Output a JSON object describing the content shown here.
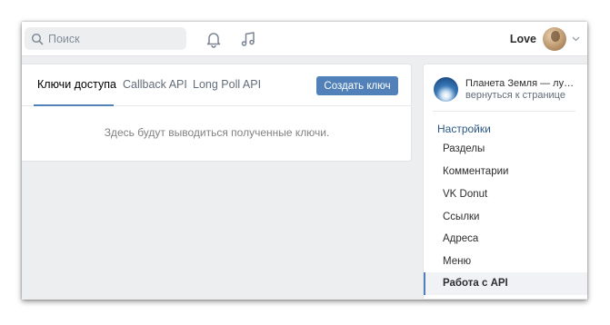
{
  "header": {
    "search": {
      "placeholder": "Поиск"
    },
    "user": {
      "name": "Love"
    }
  },
  "main": {
    "tabs": [
      {
        "label": "Ключи доступа",
        "active": true
      },
      {
        "label": "Callback API",
        "active": false
      },
      {
        "label": "Long Poll API",
        "active": false
      }
    ],
    "create_button": "Создать ключ",
    "empty_text": "Здесь будут выводиться полученные ключи."
  },
  "sidebar": {
    "community": {
      "name": "Планета Земля — лучшие фото",
      "back_link": "вернуться к странице"
    },
    "menu_title": "Настройки",
    "items": [
      {
        "label": "Разделы",
        "active": false
      },
      {
        "label": "Комментарии",
        "active": false
      },
      {
        "label": "VK Donut",
        "active": false
      },
      {
        "label": "Ссылки",
        "active": false
      },
      {
        "label": "Адреса",
        "active": false
      },
      {
        "label": "Меню",
        "active": false
      },
      {
        "label": "Работа с API",
        "active": true
      }
    ]
  },
  "colors": {
    "accent": "#5181b8",
    "background": "#edeef0",
    "link": "#2a5885"
  },
  "icons": [
    "search-icon",
    "bell-icon",
    "music-icon",
    "chevron-down-icon"
  ]
}
